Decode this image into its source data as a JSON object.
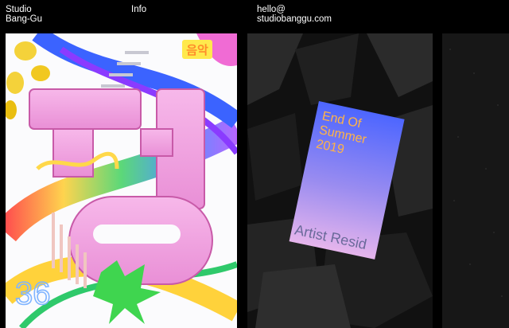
{
  "header": {
    "studio_line1": "Studio",
    "studio_line2": "Bang-Gu",
    "info_label": "Info",
    "email_line1": "hello@",
    "email_line2": "studiobanggu.com"
  },
  "poster_left": {
    "number": "36",
    "title_korean": "음악"
  },
  "poster_card": {
    "line1": "End Of",
    "line2": "Summer",
    "line3": "2019",
    "footer": "Artist Resid"
  },
  "colors": {
    "background": "#000000",
    "text": "#ffffff",
    "poster_pink": "#f3a7e4",
    "card_blue": "#4d66ff",
    "card_pink": "#e6b5ec",
    "card_text": "#ffb347"
  }
}
